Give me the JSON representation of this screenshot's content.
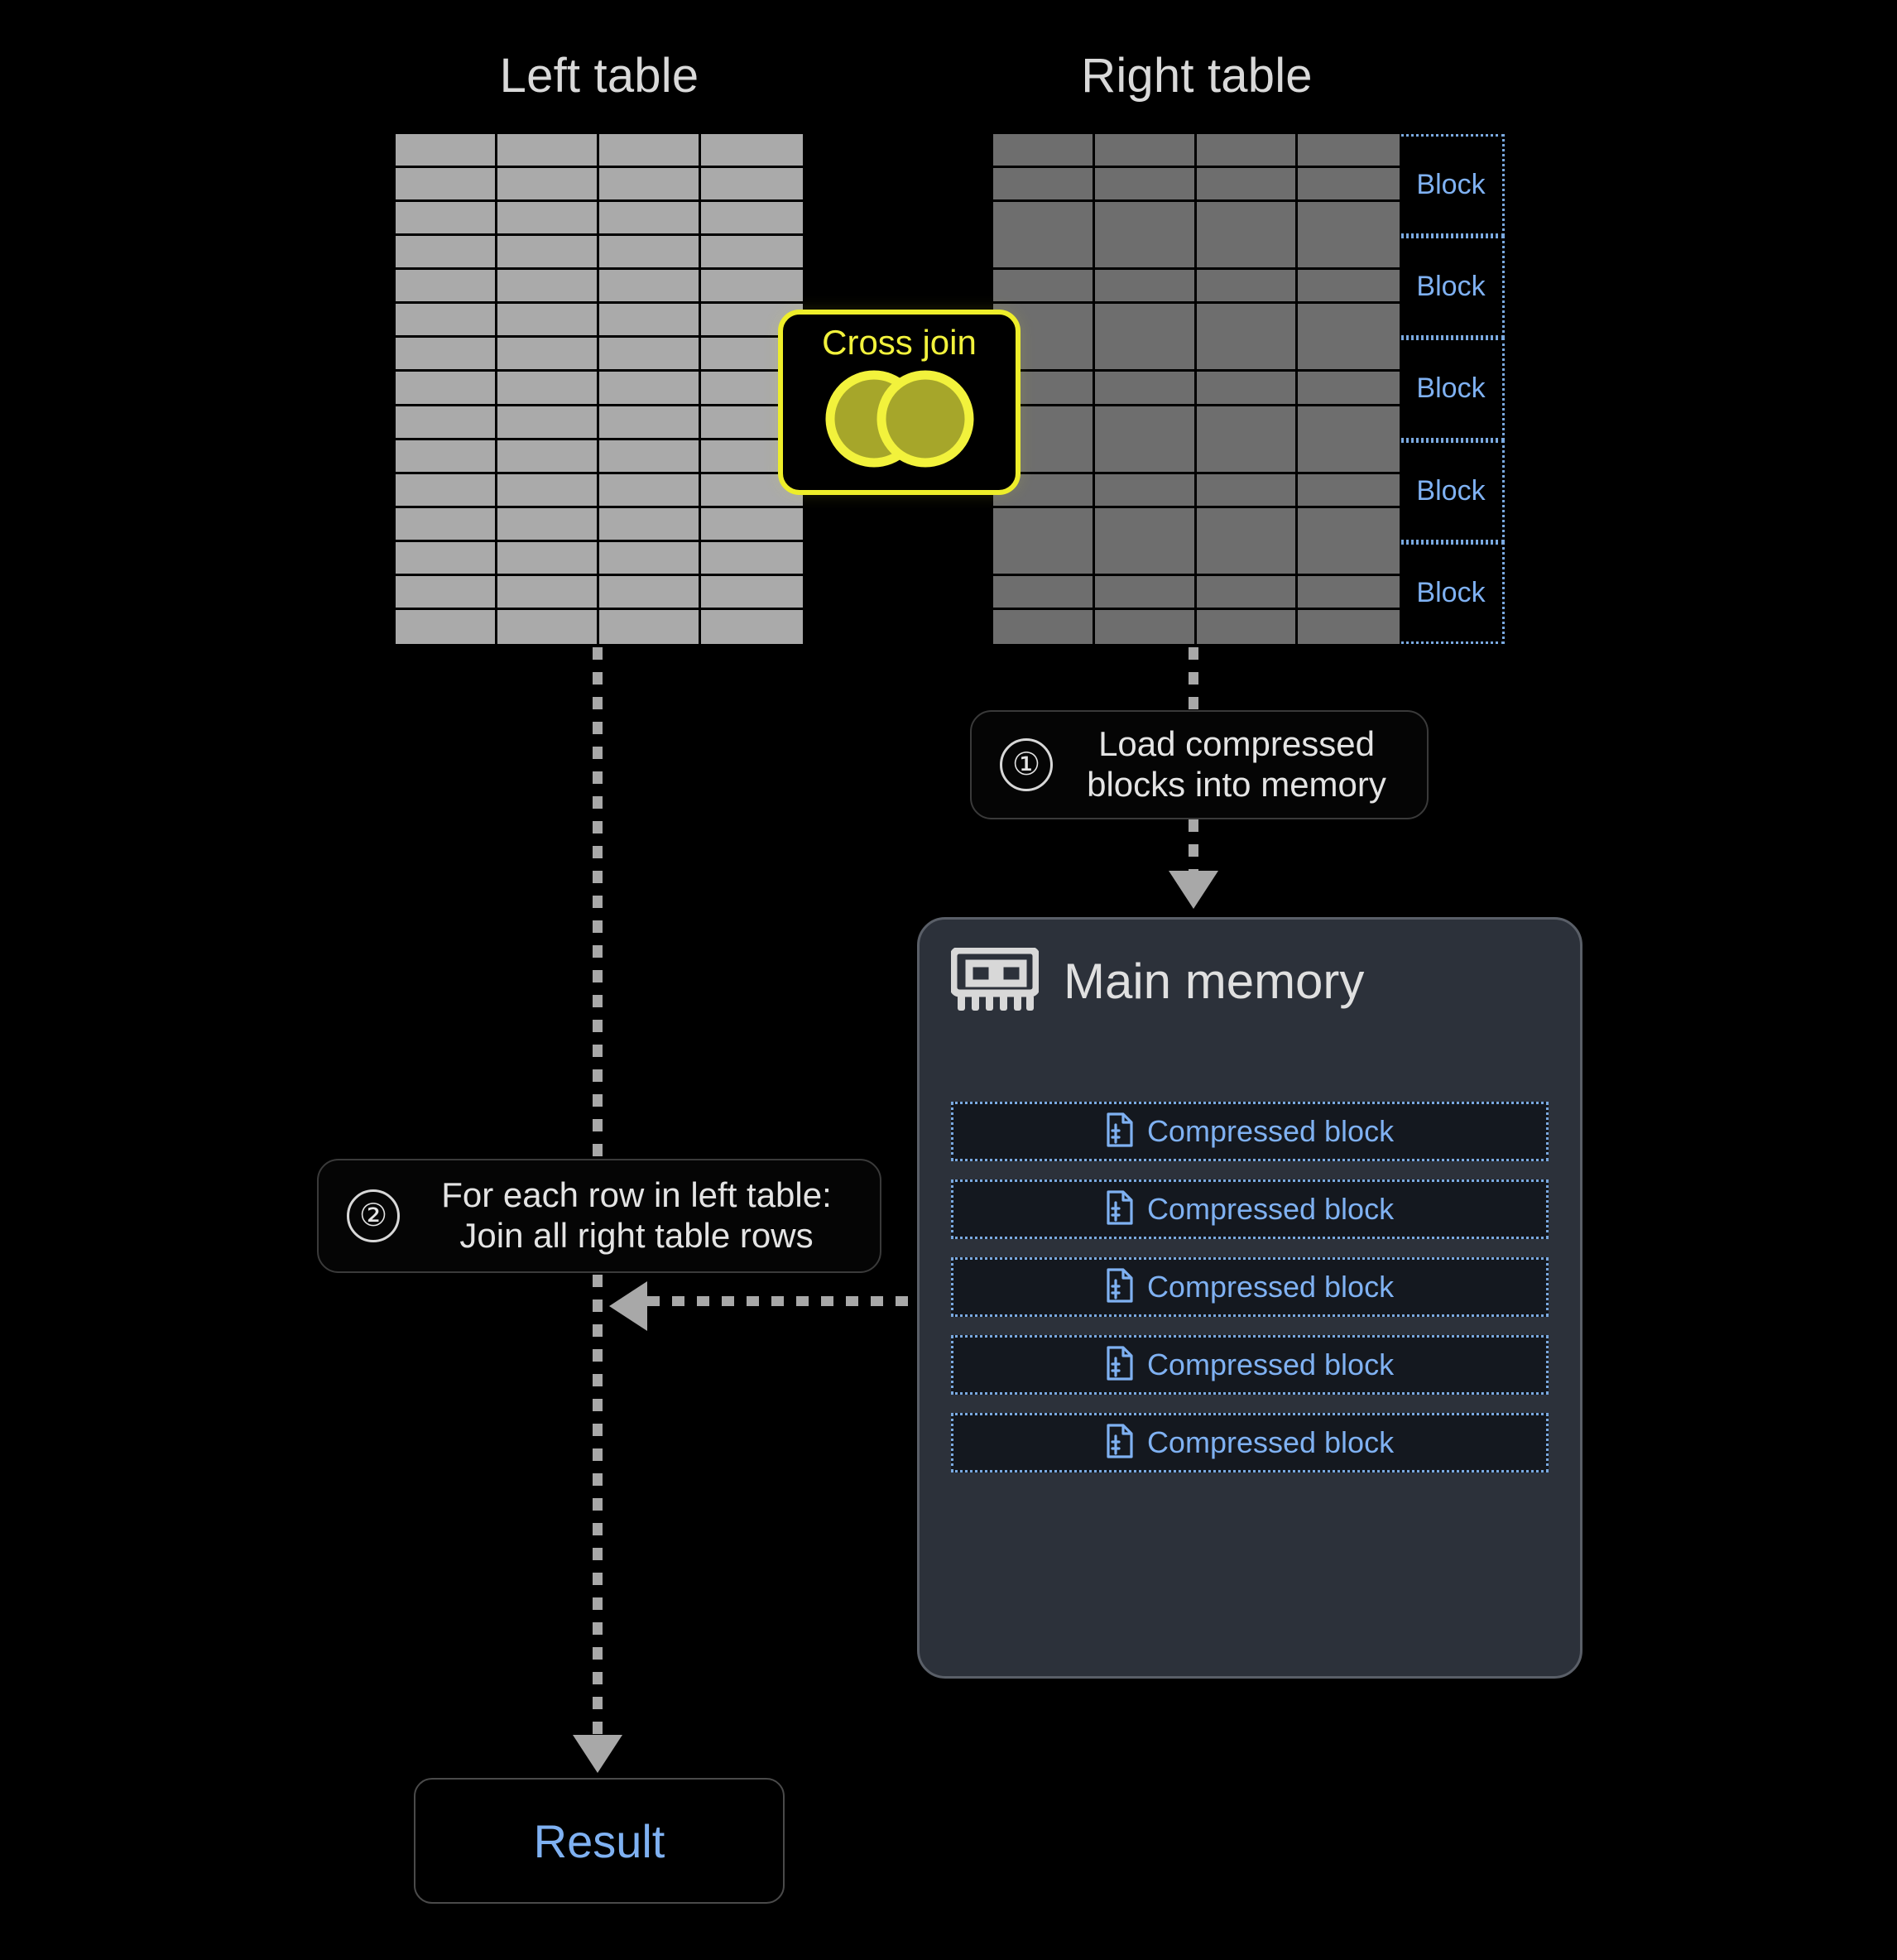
{
  "titles": {
    "left_table": "Left table",
    "right_table": "Right table"
  },
  "left_table": {
    "columns": 4,
    "rows": 15,
    "cell_color": "#aaaaaa"
  },
  "right_table": {
    "columns": 4,
    "rows_per_block": 3,
    "block_count": 5,
    "cell_color": "#6e6e6e",
    "block_outline_color": "#7aa9e0",
    "blocks": [
      {
        "label": "Block"
      },
      {
        "label": "Block"
      },
      {
        "label": "Block"
      },
      {
        "label": "Block"
      },
      {
        "label": "Block"
      }
    ]
  },
  "cross_join": {
    "label": "Cross join",
    "icon": "venn-two-circles-icon",
    "border_color": "#eeee2a",
    "fill_color": "#a6a62a"
  },
  "steps": [
    {
      "number": "①",
      "text": "Load compressed\nblocks into memory"
    },
    {
      "number": "②",
      "text": "For each row in left table:\nJoin all right table rows"
    }
  ],
  "main_memory": {
    "title": "Main memory",
    "icon": "ram-stick-icon",
    "panel_color": "#2c313a",
    "blocks": [
      {
        "label": "Compressed block",
        "icon": "compressed-file-icon"
      },
      {
        "label": "Compressed block",
        "icon": "compressed-file-icon"
      },
      {
        "label": "Compressed block",
        "icon": "compressed-file-icon"
      },
      {
        "label": "Compressed block",
        "icon": "compressed-file-icon"
      },
      {
        "label": "Compressed block",
        "icon": "compressed-file-icon"
      }
    ]
  },
  "result": {
    "label": "Result",
    "text_color": "#7fb1f2"
  }
}
